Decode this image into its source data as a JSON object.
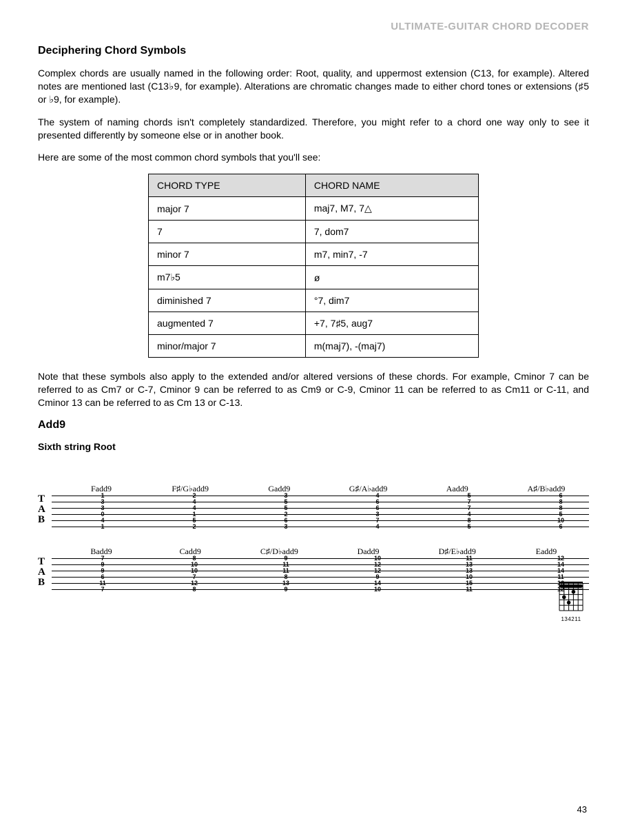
{
  "runningHead": "ULTIMATE-GUITAR CHORD DECODER",
  "section1": {
    "title": "Deciphering Chord Symbols",
    "p1": "Complex chords are usually named in the following order: Root, quality, and uppermost extension (C13, for example). Altered notes are mentioned last (C13♭9, for example). Alterations are chromatic changes made to either chord tones or extensions (♯5 or ♭9, for example).",
    "p2": "The system of naming chords isn't completely standardized. Therefore, you might refer to a chord one way only to see it presented differently by someone else or in another book.",
    "p3": "Here are some of the most common chord symbols that you'll see:"
  },
  "table": {
    "headers": [
      "CHORD TYPE",
      "CHORD NAME"
    ],
    "rows": [
      [
        "major 7",
        "maj7, M7, 7△"
      ],
      [
        "7",
        "7, dom7"
      ],
      [
        "minor 7",
        "m7, min7, -7"
      ],
      [
        "m7♭5",
        "ø"
      ],
      [
        "diminished 7",
        "°7, dim7"
      ],
      [
        "augmented 7",
        "+7, 7♯5, aug7"
      ],
      [
        "minor/major 7",
        "m(maj7), -(maj7)"
      ]
    ]
  },
  "noteText": "Note that these symbols also apply to the extended and/or altered versions of these chords. For example, Cminor 7 can be referred to as Cm7 or C-7, Cminor 9 can be referred to as Cm9 or C-9, Cminor 11 can be referred to as Cm11 or C-11, and Cminor 13 can be referred to as Cm 13 or C-13.",
  "section2": {
    "title": "Add9",
    "subhead": "Sixth string Root",
    "fingering": "134211"
  },
  "tabRow1": {
    "labels": [
      "Fadd9",
      "F♯/G♭add9",
      "Gadd9",
      "G♯/A♭add9",
      "Aadd9",
      "A♯/B♭add9"
    ],
    "cols": [
      [
        "1",
        "3",
        "3",
        "0",
        "4",
        "1"
      ],
      [
        "2",
        "4",
        "4",
        "1",
        "5",
        "2"
      ],
      [
        "3",
        "5",
        "5",
        "2",
        "6",
        "3"
      ],
      [
        "4",
        "6",
        "6",
        "3",
        "7",
        "4"
      ],
      [
        "5",
        "7",
        "7",
        "4",
        "8",
        "5"
      ],
      [
        "6",
        "8",
        "8",
        "5",
        "10",
        "6"
      ]
    ]
  },
  "tabRow2": {
    "labels": [
      "Badd9",
      "Cadd9",
      "C♯/D♭add9",
      "Dadd9",
      "D♯/E♭add9",
      "Eadd9"
    ],
    "cols": [
      [
        "7",
        "9",
        "9",
        "6",
        "11",
        "7"
      ],
      [
        "8",
        "10",
        "10",
        "7",
        "12",
        "8"
      ],
      [
        "9",
        "11",
        "11",
        "8",
        "13",
        "9"
      ],
      [
        "10",
        "12",
        "12",
        "9",
        "14",
        "10"
      ],
      [
        "11",
        "13",
        "13",
        "10",
        "15",
        "11"
      ],
      [
        "12",
        "14",
        "14",
        "11",
        "16",
        "12"
      ]
    ]
  },
  "pageNumber": "43"
}
